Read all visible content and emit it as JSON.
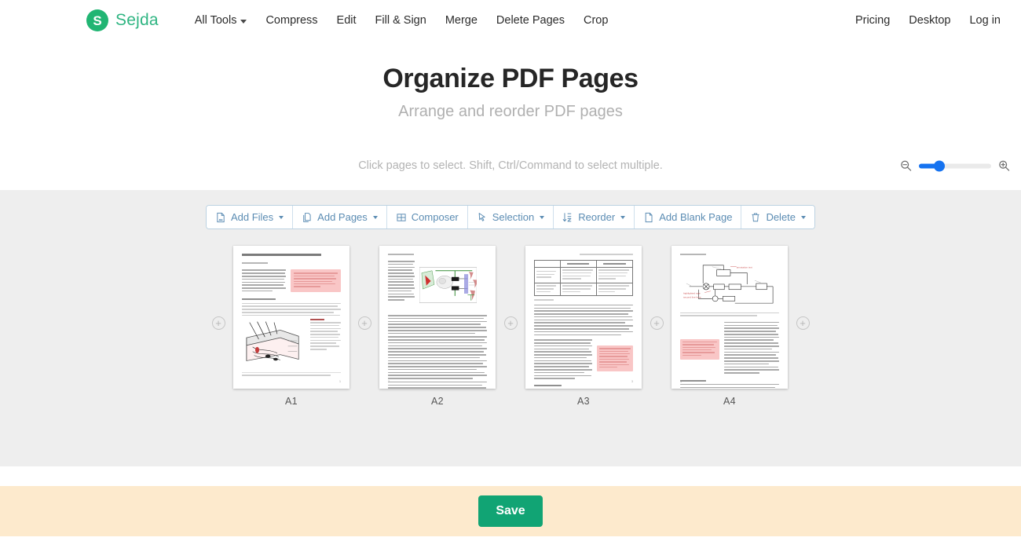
{
  "brand": {
    "mark_letter": "S",
    "name": "Sejda",
    "logo_color": "#21b573"
  },
  "nav": {
    "items": [
      {
        "label": "All Tools",
        "has_caret": true
      },
      {
        "label": "Compress",
        "has_caret": false
      },
      {
        "label": "Edit",
        "has_caret": false
      },
      {
        "label": "Fill & Sign",
        "has_caret": false
      },
      {
        "label": "Merge",
        "has_caret": false
      },
      {
        "label": "Delete Pages",
        "has_caret": false
      },
      {
        "label": "Crop",
        "has_caret": false
      }
    ],
    "right_items": [
      {
        "label": "Pricing"
      },
      {
        "label": "Desktop"
      },
      {
        "label": "Log in"
      }
    ]
  },
  "hero": {
    "title": "Organize PDF Pages",
    "subtitle": "Arrange and reorder PDF pages"
  },
  "hint": {
    "text": "Click pages to select. Shift, Ctrl/Command to select multiple."
  },
  "zoom_control": {
    "zoom_out_icon": "magnifier-minus-icon",
    "zoom_in_icon": "magnifier-plus-icon",
    "value_percent": 28,
    "accent_color": "#1673f0"
  },
  "toolbar": {
    "buttons": [
      {
        "label": "Add Files",
        "icon": "file-image-icon",
        "has_caret": true
      },
      {
        "label": "Add Pages",
        "icon": "copy-pages-icon",
        "has_caret": true
      },
      {
        "label": "Composer",
        "icon": "grid-icon",
        "has_caret": false
      },
      {
        "label": "Selection",
        "icon": "cursor-arrow-icon",
        "has_caret": true
      },
      {
        "label": "Reorder",
        "icon": "sort-az-icon",
        "has_caret": true
      },
      {
        "label": "Add Blank Page",
        "icon": "blank-page-icon",
        "has_caret": false
      },
      {
        "label": "Delete",
        "icon": "trash-icon",
        "has_caret": true
      }
    ],
    "text_color": "#5b8cb3"
  },
  "pages": [
    {
      "label": "A1",
      "kind": "title-page",
      "doc_title": "Anatomy of the Somatosensory System",
      "page_number": "1"
    },
    {
      "label": "A2",
      "kind": "diagram-page",
      "header": "Hans Hübner",
      "page_number": "2"
    },
    {
      "label": "A3",
      "kind": "table-page",
      "header": "Anatomy of the Somatosensory System",
      "page_number": "3"
    },
    {
      "label": "A4",
      "kind": "flowchart-page",
      "header": "Hans Hübner",
      "page_number": "4"
    }
  ],
  "add_slot": {
    "icon": "plus-circle-icon",
    "label": "+",
    "count": 5
  },
  "footer": {
    "save_label": "Save",
    "save_color": "#11a474",
    "background_color": "#fdeacd"
  }
}
